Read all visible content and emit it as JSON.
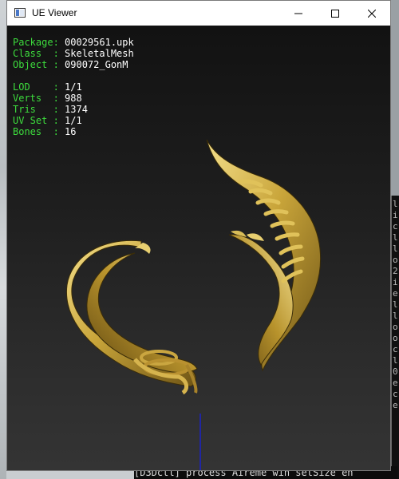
{
  "window": {
    "title": "UE Viewer"
  },
  "info": {
    "package_label": "Package: ",
    "package_value": "00029561.upk",
    "class_label": "Class  : ",
    "class_value": "SkeletalMesh",
    "object_label": "Object : ",
    "object_value": "090072_GonM",
    "lod_label": "LOD    : ",
    "lod_value": "1/1",
    "verts_label": "Verts  : ",
    "verts_value": "988",
    "tris_label": "Tris   : ",
    "tris_value": "1374",
    "uvset_label": "UV Set : ",
    "uvset_value": "1/1",
    "bones_label": "Bones  : ",
    "bones_value": "16"
  },
  "background": {
    "console_chars": [
      "l",
      "i",
      "c",
      "l",
      "l",
      "o",
      "2",
      "i",
      "e",
      "l",
      "l",
      "o",
      "o",
      "c",
      "l",
      "0",
      "e",
      "c",
      "e"
    ],
    "console_bottom_line": "[D3Dctl] process  Aireme win setSize  en"
  },
  "colors": {
    "label": "#3ddc3d",
    "value": "#ffffff",
    "mesh_gold": "#c9a53a"
  }
}
